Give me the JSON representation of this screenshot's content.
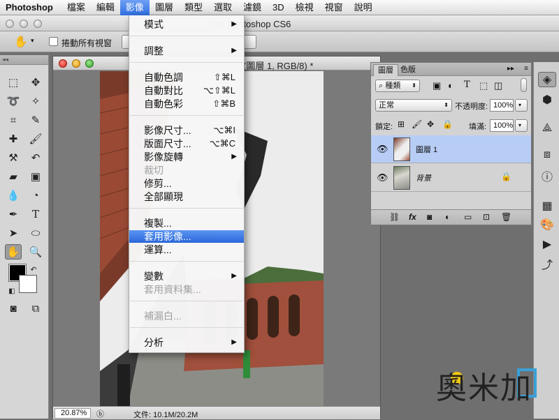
{
  "menubar": {
    "app": "Photoshop",
    "items": [
      "檔案",
      "編輯",
      "影像",
      "圖層",
      "類型",
      "選取",
      "濾鏡",
      "3D",
      "檢視",
      "視窗",
      "說明"
    ],
    "active": "影像"
  },
  "app_window": {
    "title": "obe Photoshop CS6"
  },
  "options_bar": {
    "scroll_all_label": "捲動所有視窗"
  },
  "document": {
    "title": "(圖層 1, RGB/8) *",
    "zoom": "20.87%",
    "file_info": "文件: 10.1M/20.2M"
  },
  "image_menu": {
    "items": [
      {
        "label": "模式",
        "submenu": true
      },
      {
        "label": "調整",
        "submenu": true
      },
      {
        "label": "自動色調",
        "shortcut": "⇧⌘L"
      },
      {
        "label": "自動對比",
        "shortcut": "⌥⇧⌘L"
      },
      {
        "label": "自動色彩",
        "shortcut": "⇧⌘B"
      },
      {
        "label": "影像尺寸...",
        "shortcut": "⌥⌘I"
      },
      {
        "label": "版面尺寸...",
        "shortcut": "⌥⌘C"
      },
      {
        "label": "影像旋轉",
        "submenu": true
      },
      {
        "label": "裁切",
        "disabled": true
      },
      {
        "label": "修剪..."
      },
      {
        "label": "全部顯現"
      },
      {
        "label": "複製..."
      },
      {
        "label": "套用影像...",
        "highlighted": true
      },
      {
        "label": "運算..."
      },
      {
        "label": "變數",
        "submenu": true
      },
      {
        "label": "套用資料集...",
        "disabled": true
      },
      {
        "label": "補漏白...",
        "disabled": true
      },
      {
        "label": "分析",
        "submenu": true
      }
    ]
  },
  "layers_panel": {
    "tabs": [
      "圖層",
      "色版"
    ],
    "active_tab": "圖層",
    "kind_filter": "種類",
    "blend_mode": "正常",
    "opacity_label": "不透明度:",
    "opacity_value": "100%",
    "lock_label": "鎖定:",
    "fill_label": "填滿:",
    "fill_value": "100%",
    "layers": [
      {
        "name": "圖層 1",
        "selected": true,
        "locked": false
      },
      {
        "name": "背景",
        "selected": false,
        "locked": true
      }
    ],
    "footer_fx": "fx"
  },
  "watermark": {
    "text": "奧米加"
  },
  "colors": {
    "menu_highlight": "#2f6fe0",
    "layer_selected": "#b7cdf5",
    "foreground": "#000000",
    "background": "#ffffff"
  }
}
